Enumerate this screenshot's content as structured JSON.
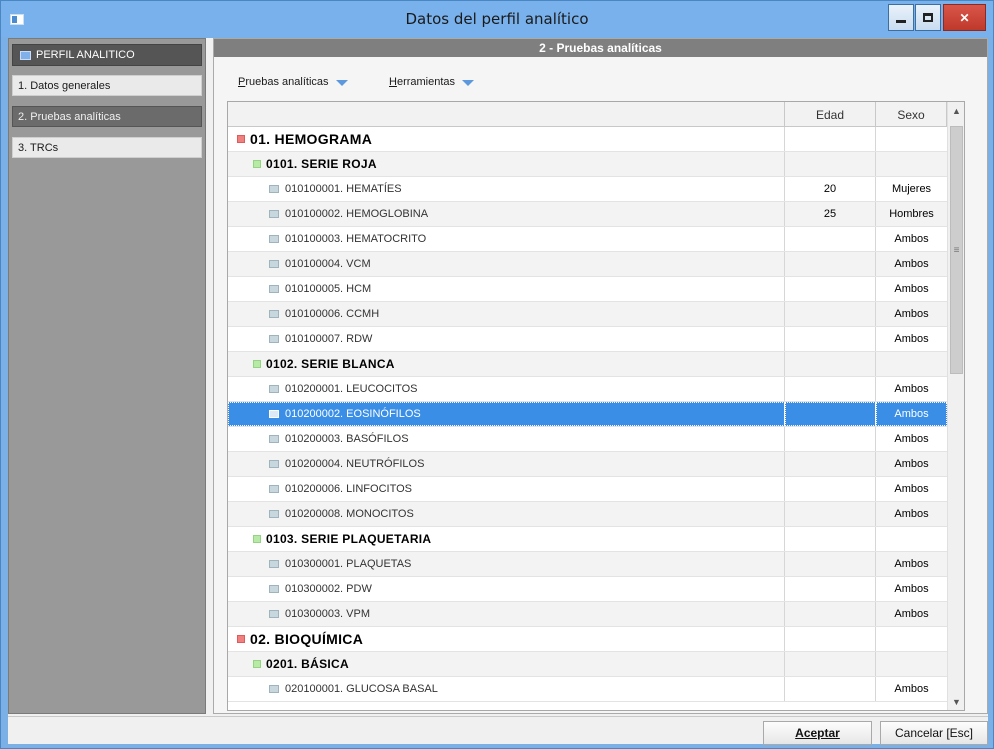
{
  "window": {
    "title": "Datos del perfil analítico"
  },
  "sidebar": {
    "header": "PERFIL ANALITICO",
    "items": [
      {
        "label": "1. Datos generales",
        "active": false
      },
      {
        "label": "2. Pruebas analíticas",
        "active": true
      },
      {
        "label": "3. TRCs",
        "active": false
      }
    ]
  },
  "main": {
    "section_title": "2 - Pruebas analíticas",
    "menus": [
      {
        "label": "Pruebas analíticas",
        "mnemonic": "P"
      },
      {
        "label": "Herramientas",
        "mnemonic": "H"
      }
    ]
  },
  "grid": {
    "columns": [
      "",
      "Edad",
      "Sexo"
    ],
    "rows": [
      {
        "level": 0,
        "name": "01. HEMOGRAMA",
        "edad": "",
        "sexo": ""
      },
      {
        "level": 1,
        "name": "0101. SERIE ROJA",
        "edad": "",
        "sexo": ""
      },
      {
        "level": 2,
        "name": "010100001. HEMATÍES",
        "edad": "20",
        "sexo": "Mujeres"
      },
      {
        "level": 2,
        "name": "010100002. HEMOGLOBINA",
        "edad": "25",
        "sexo": "Hombres"
      },
      {
        "level": 2,
        "name": "010100003. HEMATOCRITO",
        "edad": "",
        "sexo": "Ambos"
      },
      {
        "level": 2,
        "name": "010100004. VCM",
        "edad": "",
        "sexo": "Ambos"
      },
      {
        "level": 2,
        "name": "010100005. HCM",
        "edad": "",
        "sexo": "Ambos"
      },
      {
        "level": 2,
        "name": "010100006. CCMH",
        "edad": "",
        "sexo": "Ambos"
      },
      {
        "level": 2,
        "name": "010100007. RDW",
        "edad": "",
        "sexo": "Ambos"
      },
      {
        "level": 1,
        "name": "0102. SERIE BLANCA",
        "edad": "",
        "sexo": ""
      },
      {
        "level": 2,
        "name": "010200001. LEUCOCITOS",
        "edad": "",
        "sexo": "Ambos"
      },
      {
        "level": 2,
        "name": "010200002. EOSINÓFILOS",
        "edad": "",
        "sexo": "Ambos",
        "selected": true
      },
      {
        "level": 2,
        "name": "010200003. BASÓFILOS",
        "edad": "",
        "sexo": "Ambos"
      },
      {
        "level": 2,
        "name": "010200004. NEUTRÓFILOS",
        "edad": "",
        "sexo": "Ambos"
      },
      {
        "level": 2,
        "name": "010200006. LINFOCITOS",
        "edad": "",
        "sexo": "Ambos"
      },
      {
        "level": 2,
        "name": "010200008. MONOCITOS",
        "edad": "",
        "sexo": "Ambos"
      },
      {
        "level": 1,
        "name": "0103. SERIE PLAQUETARIA",
        "edad": "",
        "sexo": ""
      },
      {
        "level": 2,
        "name": "010300001. PLAQUETAS",
        "edad": "",
        "sexo": "Ambos"
      },
      {
        "level": 2,
        "name": "010300002. PDW",
        "edad": "",
        "sexo": "Ambos"
      },
      {
        "level": 2,
        "name": "010300003. VPM",
        "edad": "",
        "sexo": "Ambos"
      },
      {
        "level": 0,
        "name": "02. BIOQUÍMICA",
        "edad": "",
        "sexo": ""
      },
      {
        "level": 1,
        "name": "0201. BÁSICA",
        "edad": "",
        "sexo": ""
      },
      {
        "level": 2,
        "name": "020100001. GLUCOSA BASAL",
        "edad": "",
        "sexo": "Ambos"
      }
    ]
  },
  "buttons": {
    "accept": "Aceptar",
    "cancel": "Cancelar [Esc]"
  },
  "colors": {
    "title_bar": "#79b1ec",
    "selection": "#3a8ee6",
    "section_header": "#7f7f7f",
    "close_button": "#c0392b"
  },
  "icons": {
    "level0": "red-square-icon",
    "level1": "green-square-icon",
    "level2": "grey-item-icon"
  }
}
